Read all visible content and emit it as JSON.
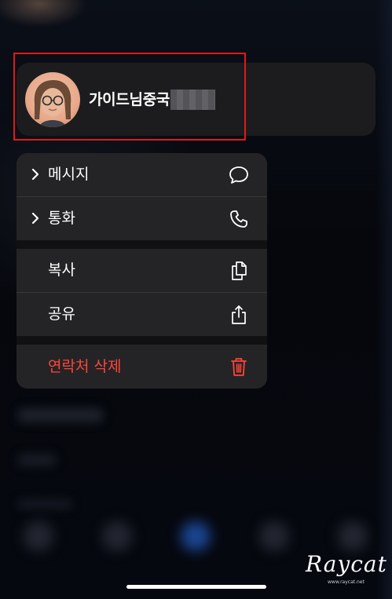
{
  "contact": {
    "name": "가이드님중국"
  },
  "menu": {
    "items": [
      {
        "label": "메시지",
        "icon": "message-bubble-icon",
        "has_chevron": true
      },
      {
        "label": "통화",
        "icon": "phone-icon",
        "has_chevron": true
      },
      {
        "label": "복사",
        "icon": "copy-icon",
        "has_chevron": false
      },
      {
        "label": "공유",
        "icon": "share-icon",
        "has_chevron": false
      },
      {
        "label": "연락처 삭제",
        "icon": "trash-icon",
        "has_chevron": false,
        "destructive": true
      }
    ]
  },
  "watermark": {
    "text": "Raycat",
    "url": "www.raycat.net"
  },
  "colors": {
    "destructive": "#ff4438",
    "highlight": "#e01a1a",
    "menu_bg": "#242426"
  }
}
